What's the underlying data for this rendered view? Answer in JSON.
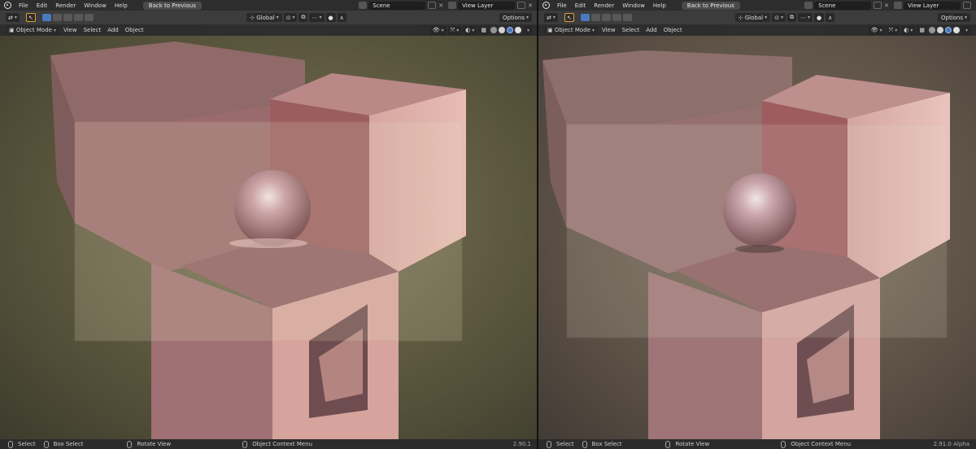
{
  "left": {
    "menu": [
      "File",
      "Edit",
      "Render",
      "Window",
      "Help"
    ],
    "back_label": "Back to Previous",
    "scene": "Scene",
    "view_layer": "View Layer",
    "orientation": "Global",
    "options": "Options",
    "mode": "Object Mode",
    "header_menus": [
      "View",
      "Select",
      "Add",
      "Object"
    ],
    "status": [
      "Select",
      "Box Select",
      "Rotate View",
      "Object Context Menu"
    ],
    "version": "2.90.1"
  },
  "right": {
    "menu": [
      "File",
      "Edit",
      "Render",
      "Window",
      "Help"
    ],
    "back_label": "Back to Previous",
    "scene": "Scene",
    "view_layer": "View Layer",
    "orientation": "Global",
    "options": "Options",
    "mode": "Object Mode",
    "header_menus": [
      "View",
      "Select",
      "Add",
      "Object"
    ],
    "status": [
      "Select",
      "Box Select",
      "Rotate View",
      "Object Context Menu"
    ],
    "version": "2.91.0 Alpha"
  },
  "colors": {
    "accent": "#e0a030",
    "viewport_bg": "#4a4630",
    "object_pink": "#c99590"
  },
  "icons": {
    "logo": "blender-logo-icon",
    "tool": "select-cursor-icon",
    "mouse": "mouse-icon"
  }
}
